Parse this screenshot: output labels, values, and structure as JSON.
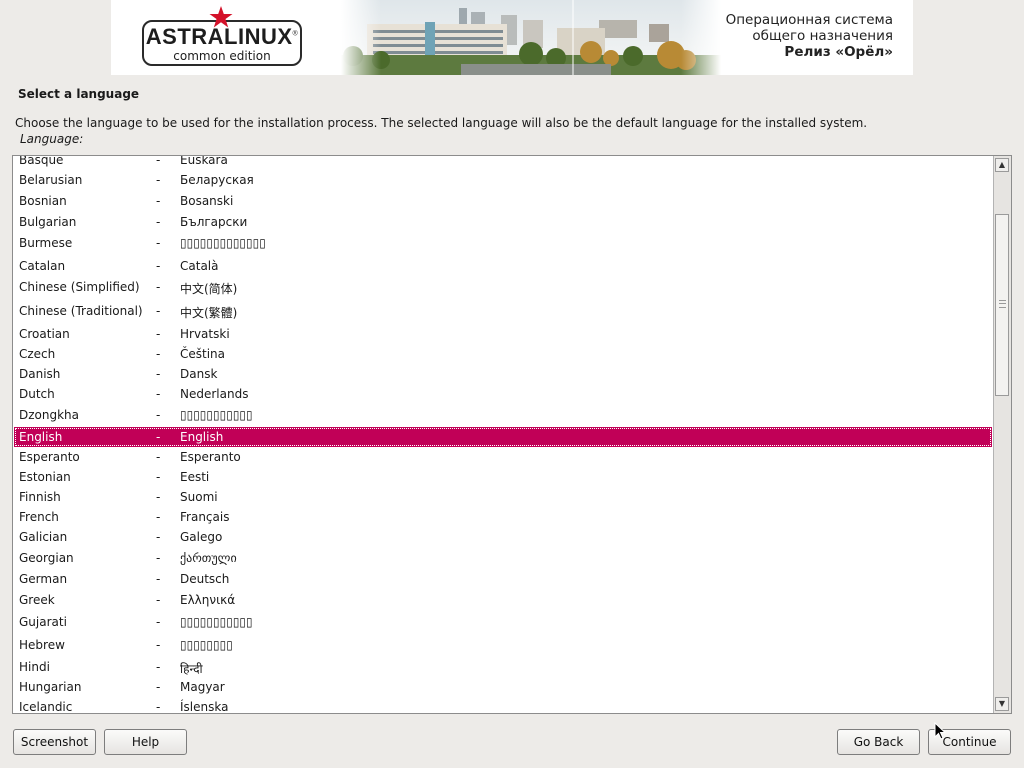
{
  "banner": {
    "logo_text": "ASTRALINUX",
    "logo_registered": "®",
    "logo_sub": "common edition",
    "line1": "Операционная система",
    "line2": "общего назначения",
    "line3": "Релиз «Орёл»"
  },
  "page": {
    "title": "Select a language",
    "description": "Choose the language to be used for the installation process. The selected language will also be the default language for the installed system.",
    "field_label": "Language:"
  },
  "languages": [
    {
      "name": "Basque",
      "dash": "-",
      "native": "Euskara"
    },
    {
      "name": "Belarusian",
      "dash": "-",
      "native": "Беларуская"
    },
    {
      "name": "Bosnian",
      "dash": "-",
      "native": "Bosanski"
    },
    {
      "name": "Bulgarian",
      "dash": "-",
      "native": "Български"
    },
    {
      "name": "Burmese",
      "dash": "-",
      "native": "▯▯▯▯▯▯▯▯▯▯▯▯▯"
    },
    {
      "name": "Catalan",
      "dash": "-",
      "native": "Català"
    },
    {
      "name": "Chinese (Simplified)",
      "dash": "-",
      "native": "中文(简体)"
    },
    {
      "name": "Chinese (Traditional)",
      "dash": "-",
      "native": "中文(繁體)"
    },
    {
      "name": "Croatian",
      "dash": "-",
      "native": "Hrvatski"
    },
    {
      "name": "Czech",
      "dash": "-",
      "native": "Čeština"
    },
    {
      "name": "Danish",
      "dash": "-",
      "native": "Dansk"
    },
    {
      "name": "Dutch",
      "dash": "-",
      "native": "Nederlands"
    },
    {
      "name": "Dzongkha",
      "dash": "-",
      "native": "▯▯▯▯▯▯▯▯▯▯▯"
    },
    {
      "name": "English",
      "dash": "-",
      "native": "English",
      "selected": true
    },
    {
      "name": "Esperanto",
      "dash": "-",
      "native": "Esperanto"
    },
    {
      "name": "Estonian",
      "dash": "-",
      "native": "Eesti"
    },
    {
      "name": "Finnish",
      "dash": "-",
      "native": "Suomi"
    },
    {
      "name": "French",
      "dash": "-",
      "native": "Français"
    },
    {
      "name": "Galician",
      "dash": "-",
      "native": "Galego"
    },
    {
      "name": "Georgian",
      "dash": "-",
      "native": "ქართული"
    },
    {
      "name": "German",
      "dash": "-",
      "native": "Deutsch"
    },
    {
      "name": "Greek",
      "dash": "-",
      "native": "Ελληνικά"
    },
    {
      "name": "Gujarati",
      "dash": "-",
      "native": "▯▯▯▯▯▯▯▯▯▯▯"
    },
    {
      "name": "Hebrew",
      "dash": "-",
      "native": "▯▯▯▯▯▯▯▯"
    },
    {
      "name": "Hindi",
      "dash": "-",
      "native": "हिन्दी"
    },
    {
      "name": "Hungarian",
      "dash": "-",
      "native": "Magyar"
    },
    {
      "name": "Icelandic",
      "dash": "-",
      "native": "Íslenska"
    }
  ],
  "buttons": {
    "screenshot": "Screenshot",
    "help": "Help",
    "go_back": "Go Back",
    "continue": "Continue"
  },
  "colors": {
    "selection": "#c10057",
    "background": "#edebe8"
  }
}
